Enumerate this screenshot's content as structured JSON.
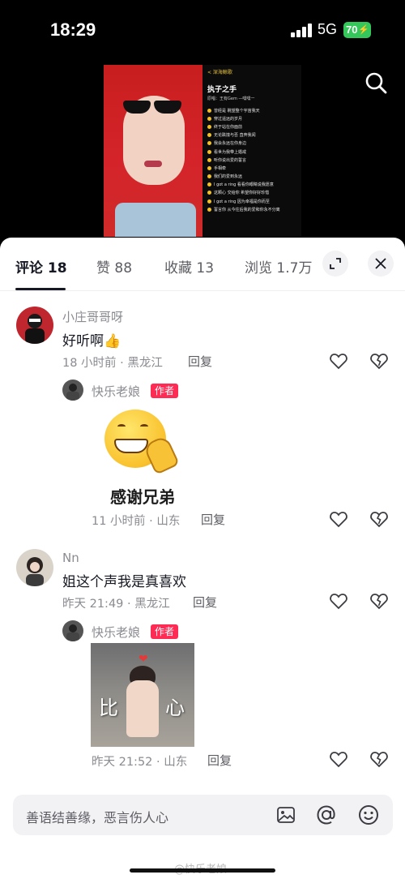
{
  "status_bar": {
    "time": "18:29",
    "network": "5G",
    "battery": "70"
  },
  "video": {
    "lyrics_back": "< 深海鲸歌",
    "song_title": "执子之手",
    "song_artist": "原唱：王有Gem —嘿嘿一",
    "lyrics": [
      "曾经是 眺望整个宇宙我天",
      "穿过遥远的岁月",
      "终于站在你面前",
      "无论跌撞与否 直奔我闻",
      "我会永远在你身边",
      "看世为我带上婚戒",
      "听你说出爱的誓言",
      "手相牵",
      "我们的爱到永远",
      "I got a ring 看看你眼睛说我愿意",
      "这颗心 交给你 希望你好好珍惜",
      "I got a ring 因为幸福是你而至",
      "誓言你 从今往后我的爱和你永不分离"
    ]
  },
  "tabs": [
    {
      "label": "评论 18",
      "active": true
    },
    {
      "label": "赞 88",
      "active": false
    },
    {
      "label": "收藏 13",
      "active": false
    },
    {
      "label": "浏览 1.7万",
      "active": false
    }
  ],
  "comments": [
    {
      "user": "小庄哥哥呀",
      "text": "好听啊",
      "emoji": "👍",
      "time_location": "18 小时前 · 黑龙江",
      "reply_label": "回复",
      "reply": {
        "user": "快乐老娘",
        "badge": "作者",
        "sticker_caption": "感谢兄弟",
        "time_location": "11 小时前 · 山东",
        "reply_label": "回复"
      }
    },
    {
      "user": "Nn",
      "text": "姐这个声我是真喜欢",
      "time_location": "昨天 21:49 · 黑龙江",
      "reply_label": "回复",
      "reply": {
        "user": "快乐老娘",
        "badge": "作者",
        "sticker_left": "比",
        "sticker_right": "心",
        "time_location": "昨天 21:52 · 山东",
        "reply_label": "回复"
      }
    }
  ],
  "input": {
    "placeholder": "善语结善缘，恶言伤人心"
  },
  "watermark": "@快乐老娘",
  "colors": {
    "accent": "#fe2c55",
    "battery": "#34c759",
    "lyric_dot": "#f3c024"
  }
}
